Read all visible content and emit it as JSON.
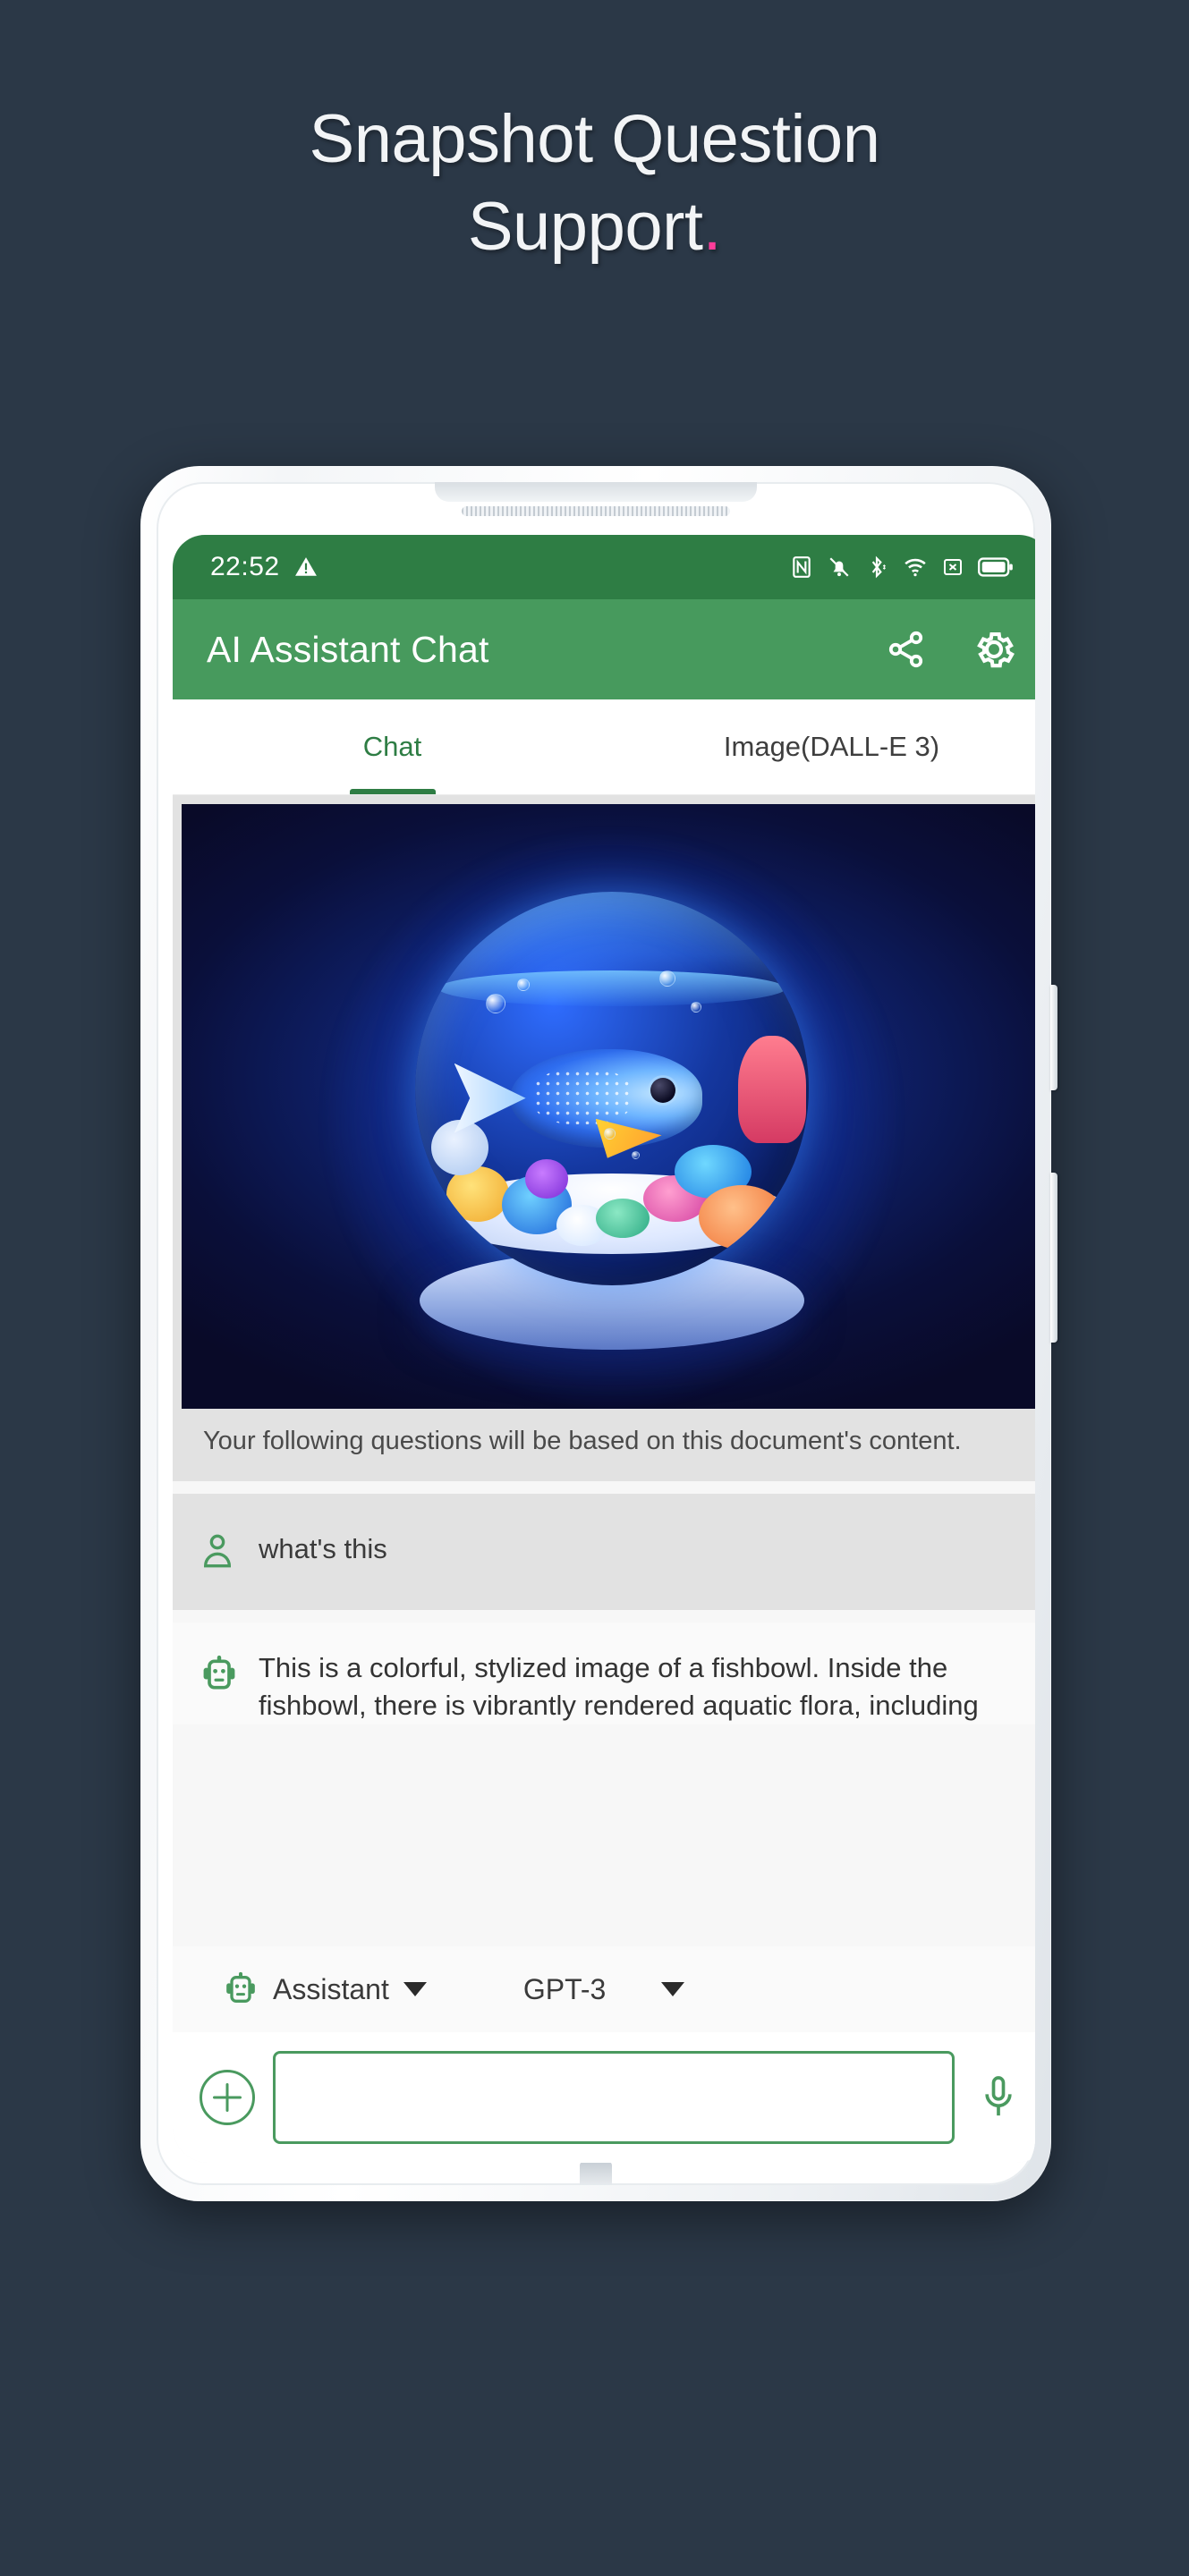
{
  "marketing": {
    "headline_line1": "Snapshot Question",
    "headline_line2": "Support",
    "headline_accent": ".",
    "accent_color": "#ff3d9a",
    "background_color": "#2b3847"
  },
  "status_bar": {
    "time": "22:52",
    "icons": [
      "warning-triangle-icon",
      "nfc-icon",
      "bell-muted-icon",
      "bluetooth-icon",
      "wifi-icon",
      "sim-x-icon",
      "battery-icon"
    ],
    "background_color": "#2e7d44"
  },
  "app_bar": {
    "title": "AI Assistant Chat",
    "background_color": "#479a5d",
    "actions": [
      "share-icon",
      "gear-icon"
    ]
  },
  "tabs": {
    "active_index": 0,
    "items": [
      {
        "label": "Chat"
      },
      {
        "label": "Image(DALL-E 3)"
      }
    ],
    "active_color": "#2e7d44"
  },
  "conversation": {
    "snapshot": {
      "alt": "fishbowl-snapshot",
      "caption": "Your following questions will be based on this document's content."
    },
    "user_message": {
      "avatar": "person-icon",
      "text": "what's this"
    },
    "assistant_message": {
      "avatar": "robot-icon",
      "text": "This is a colorful, stylized image of a fishbowl. Inside the fishbowl, there is vibrantly rendered aquatic flora, including"
    }
  },
  "controls": {
    "role_label": "Assistant",
    "role_icon": "robot-icon",
    "role_caret": "chevron-down-icon",
    "model_label": "GPT-3",
    "model_caret": "chevron-down-icon"
  },
  "input_bar": {
    "add_icon": "plus-circle-icon",
    "input_value": "",
    "input_placeholder": "",
    "mic_icon": "microphone-icon",
    "accent_color": "#4a9a5f"
  }
}
